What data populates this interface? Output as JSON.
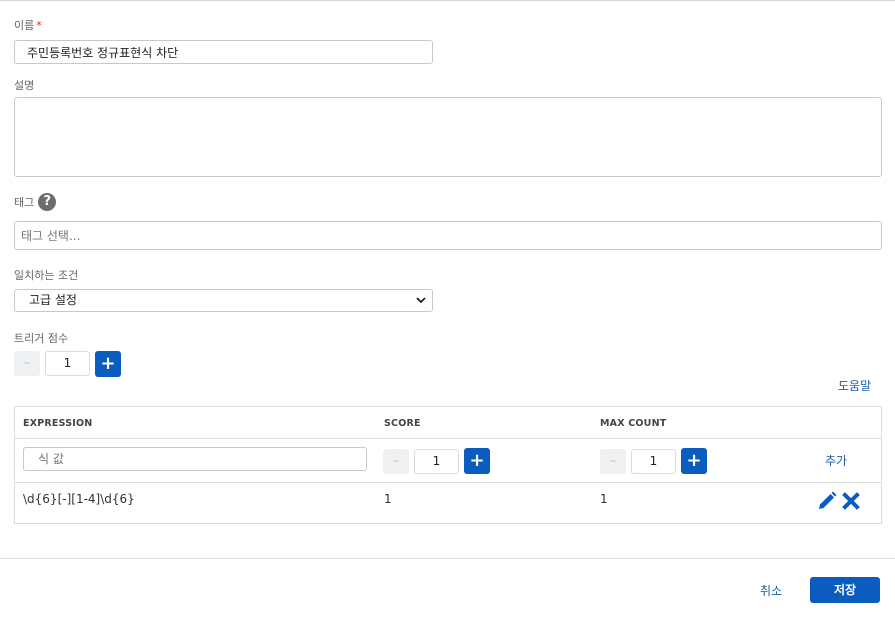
{
  "form": {
    "name_label": "이름",
    "required_mark": "*",
    "name_value": "주민등록번호 정규표현식 차단",
    "description_label": "설명",
    "tags_label": "태그",
    "help_glyph": "?",
    "tags_placeholder": "태그 선택...",
    "match_condition_label": "일치하는 조건",
    "match_condition_value": "고급 설정",
    "trigger_score_label": "트리거 점수",
    "trigger_score_value": "1",
    "help_link": "도움말"
  },
  "table": {
    "headers": [
      "EXPRESSION",
      "SCORE",
      "MAX COUNT"
    ],
    "new_row": {
      "expression_placeholder": "식 값",
      "score_value": "1",
      "max_count_value": "1",
      "add_label": "추가"
    },
    "rows": [
      {
        "expression": "\\d{6}[-][1-4]\\d{6}",
        "score": "1",
        "max_count": "1"
      }
    ]
  },
  "stepper": {
    "minus_glyph": "–",
    "plus_glyph": "+"
  },
  "footer": {
    "cancel_label": "취소",
    "save_label": "저장"
  },
  "colors": {
    "primary": "#0b5cbf",
    "link": "#1c5fa8",
    "required": "#e02020",
    "border": "#c8c8c8"
  },
  "icons": [
    "help-icon",
    "chevron-down-icon",
    "pencil-icon",
    "close-icon"
  ]
}
